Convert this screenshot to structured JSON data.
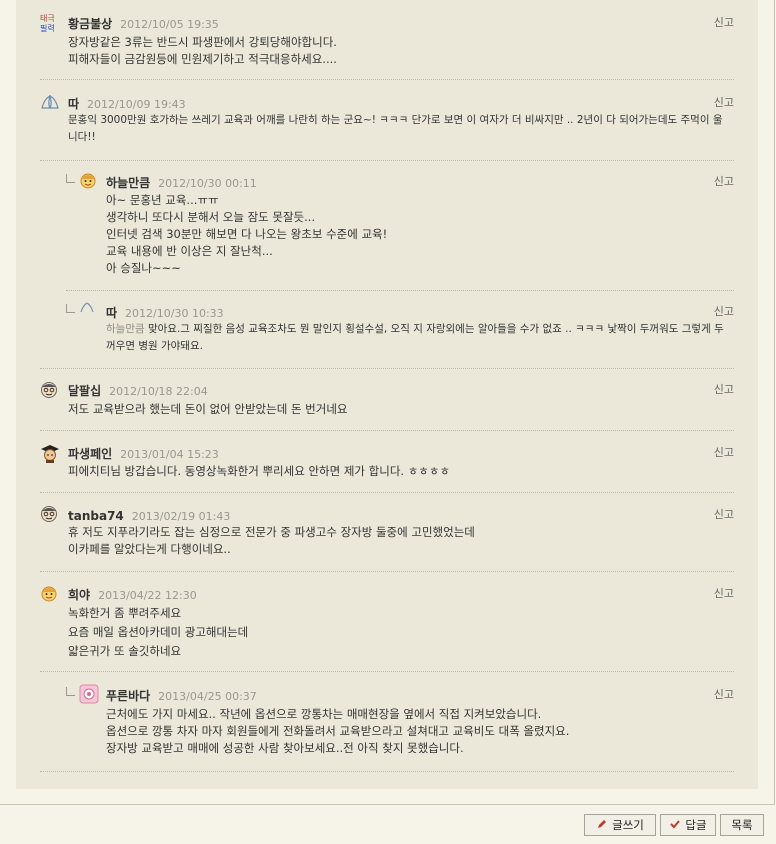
{
  "comments": [
    {
      "nick": "황금불상",
      "date": "2012/10/05 19:35",
      "report": "신고",
      "text": "장자방같은 3류는 반드시 파생판에서 강퇴당해야합니다.\n피해자들이 금감원등에 민원제기하고 적극대응하세요...."
    },
    {
      "nick": "따",
      "date": "2012/10/09 19:43",
      "report": "신고",
      "text": "문홍익 3000만원 호가하는 쓰레기 교육과 어깨를 나란히 하는 군요~! ㅋㅋㅋ 단가로 보면 이 여자가 더 비싸지만 .. 2년이 다 되어가는데도 주먹이 울니다!!"
    },
    {
      "nick": "하늘만큼",
      "date": "2012/10/30 00:11",
      "report": "신고",
      "text": "아~ 문홍년 교육...ㅠㅠ\n생각하니 또다시 분해서 오늘 잠도 못잘듯...\n인터넷 검색 30분만 해보면 다 나오는 왕초보 수준에 교육!\n교육 내용에 반 이상은 지 잘난척...\n아 승질나~~~"
    },
    {
      "nick": "따",
      "date": "2012/10/30 10:33",
      "report": "신고",
      "mention": "하늘만큼",
      "text": " 맞아요.그 찌질한 음성 교육조차도 뭔 말인지 횡설수설, 오직 지 자랑외에는 알아들을 수가 없죠 .. ㅋㅋㅋ 낯짝이 두꺼워도 그렇게 두꺼우면 병원 가야돼요."
    },
    {
      "nick": "달팔십",
      "date": "2012/10/18 22:04",
      "report": "신고",
      "text": "저도 교육받으라 했는데 돈이 없어 안받았는데 돈 번거네요"
    },
    {
      "nick": "파생페인",
      "date": "2013/01/04 15:23",
      "report": "신고",
      "text": "피에치티님 방갑습니다. 동영상녹화한거 뿌리세요 안하면 제가 합니다. ㅎㅎㅎㅎ"
    },
    {
      "nick": "tanba74",
      "date": "2013/02/19 01:43",
      "report": "신고",
      "text": "휴 저도 지푸라기라도 잡는 심정으로 전문가 중 파생고수 장자방 둘중에 고민했었는데\n이카페를 알았다는게 다행이네요.."
    },
    {
      "nick": "희야",
      "date": "2013/04/22 12:30",
      "report": "신고",
      "text": "녹화한거 좀 뿌려주세요\n요즘 매일 옵션아카데미 광고해대는데\n얇은귀가 또 솔깃하네요"
    },
    {
      "nick": "푸른바다",
      "date": "2013/04/25 00:37",
      "report": "신고",
      "text": "근처에도 가지 마세요.. 작년에 옵션으로 깡통차는 매매현장을 옆에서 직접 지켜보았습니다.\n옵션으로 깡통 차자 마자 회원들에게 전화돌려서 교육받으라고 설쳐대고 교육비도 대폭 올렸지요.\n장자방 교육받고 매매에 성공한 사람 찾아보세요..전 아직 찾지 못했습니다."
    }
  ],
  "buttons": {
    "write": "글쓰기",
    "reply": "답글",
    "list": "목록"
  },
  "icons": {
    "write": "pencil-icon",
    "reply": "check-icon"
  },
  "colors": {
    "accent": "#c0392b",
    "background": "#ebe8da"
  }
}
